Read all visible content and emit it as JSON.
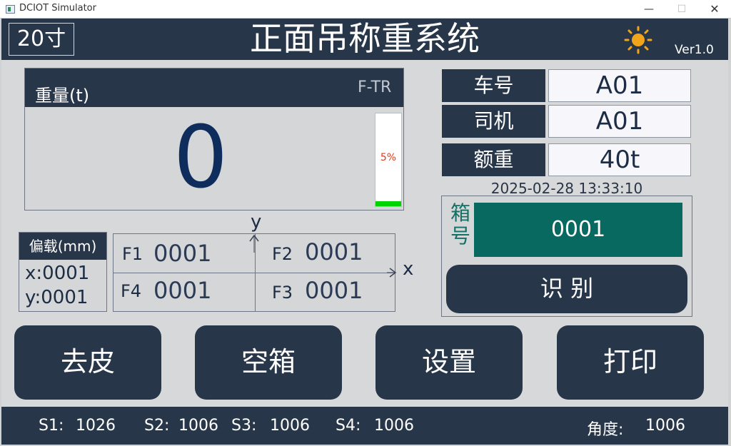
{
  "window": {
    "title": "DCIOT Simulator",
    "minimize": "—",
    "maximize": "☐",
    "close": "✕"
  },
  "header": {
    "size_badge": "20寸",
    "title": "正面吊称重系统",
    "version": "Ver1.0",
    "status_icon": "sun-icon"
  },
  "weight": {
    "label": "重量(t)",
    "mode": "F-TR",
    "value": "0",
    "level_percent_label": "5%",
    "level_fraction": 0.05
  },
  "vehicle": {
    "car_no_label": "车号",
    "car_no": "A01",
    "driver_label": "司机",
    "driver": "A01",
    "rated_label": "额重",
    "rated": "40t",
    "datetime": "2025-02-28 13:33:10"
  },
  "box": {
    "label": "箱号",
    "value": "0001",
    "recognize_button": "识 别"
  },
  "offset": {
    "title": "偏载(mm)",
    "x_label": "x:",
    "x_value": "0001",
    "y_label": "y:",
    "y_value": "0001"
  },
  "sensors": {
    "y_axis": "y",
    "x_axis": "x",
    "f1_label": "F1",
    "f1": "0001",
    "f2_label": "F2",
    "f2": "0001",
    "f3_label": "F3",
    "f3": "0001",
    "f4_label": "F4",
    "f4": "0001"
  },
  "buttons": {
    "tare": "去皮",
    "empty_box": "空箱",
    "settings": "设置",
    "print": "打印"
  },
  "status": {
    "s1_label": "S1:",
    "s1": "1026",
    "s2_label": "S2:",
    "s2": "1006",
    "s3_label": "S3:",
    "s3": "1006",
    "s4_label": "S4:",
    "s4": "1006",
    "angle_label": "角度:",
    "angle": "1006"
  },
  "colors": {
    "panel_dark": "#283649",
    "box_green": "#07695f",
    "level_green": "#00d400",
    "level_text": "#e03a1a",
    "sun": "#f2a51a"
  }
}
